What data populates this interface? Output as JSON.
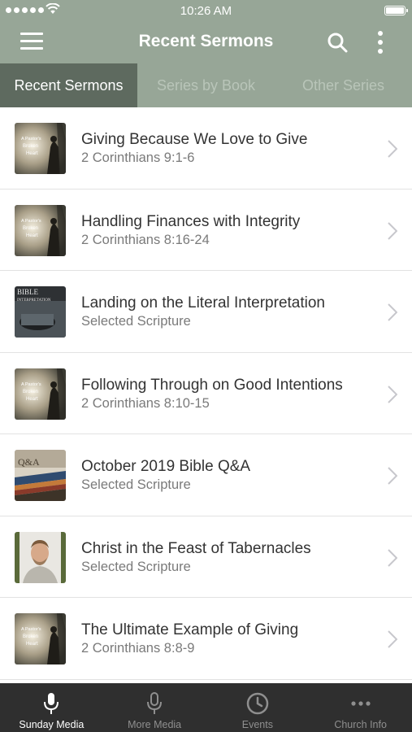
{
  "status_bar": {
    "time": "10:26 AM",
    "battery_level": 1.0
  },
  "navbar": {
    "title": "Recent Sermons",
    "menu_icon": "hamburger-icon",
    "search_icon": "search-icon",
    "more_icon": "vertical-ellipsis-icon"
  },
  "tabs": [
    {
      "label": "Recent Sermons",
      "active": true
    },
    {
      "label": "Series by Book",
      "active": false
    },
    {
      "label": "Other Series",
      "active": false
    }
  ],
  "sermons": [
    {
      "title": "Giving Because We Love to Give",
      "reference": "2 Corinthians 9:1-6",
      "thumb_text": [
        "A Pastor's",
        "Broken",
        "Heart"
      ]
    },
    {
      "title": "Handling Finances with Integrity",
      "reference": "2 Corinthians 8:16-24",
      "thumb_text": [
        "A Pastor's",
        "Broken",
        "Heart"
      ]
    },
    {
      "title": "Landing on the Literal Interpretation",
      "reference": "Selected Scripture",
      "thumb_text": [
        "BIBLE",
        "INTERPRETATION"
      ]
    },
    {
      "title": "Following Through on Good Intentions",
      "reference": "2 Corinthians 8:10-15",
      "thumb_text": [
        "A Pastor's",
        "Broken",
        "Heart"
      ]
    },
    {
      "title": "October 2019 Bible Q&A",
      "reference": "Selected Scripture",
      "thumb_text": [
        "Q&A"
      ]
    },
    {
      "title": "Christ in the Feast of Tabernacles",
      "reference": "Selected Scripture",
      "thumb_text": []
    },
    {
      "title": "The Ultimate Example of Giving",
      "reference": "2 Corinthians 8:8-9",
      "thumb_text": [
        "A Pastor's",
        "Broken",
        "Heart"
      ]
    }
  ],
  "bottom_tabs": [
    {
      "label": "Sunday Media",
      "icon": "microphone-icon",
      "active": true
    },
    {
      "label": "More Media",
      "icon": "microphone-icon",
      "active": false
    },
    {
      "label": "Events",
      "icon": "clock-icon",
      "active": false
    },
    {
      "label": "Church Info",
      "icon": "ellipsis-icon",
      "active": false
    }
  ],
  "colors": {
    "header": "#97a697",
    "active_tab": "#5e6a5f",
    "tab_bar": "#2f2f2f"
  }
}
